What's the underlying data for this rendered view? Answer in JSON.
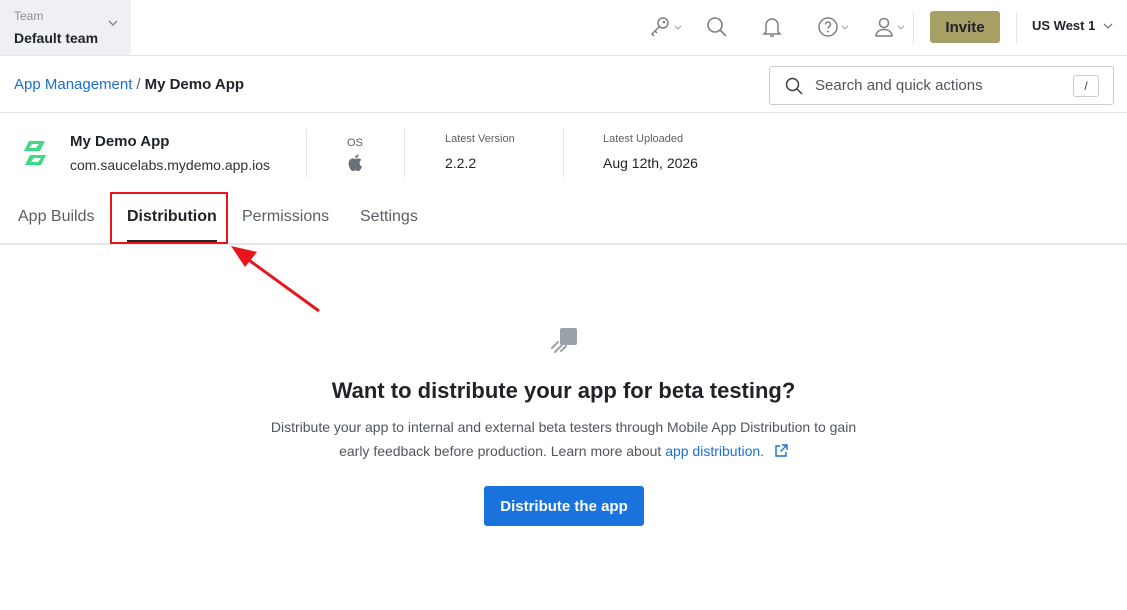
{
  "header": {
    "team_label": "Team",
    "team_name": "Default team",
    "invite_label": "Invite",
    "region_label": "US West 1",
    "icons": [
      "key-icon",
      "search-icon",
      "bell-icon",
      "help-icon",
      "user-icon"
    ]
  },
  "breadcrumb": {
    "parent": "App Management",
    "separator": "/",
    "current": "My Demo App"
  },
  "search": {
    "placeholder": "Search and quick actions",
    "shortcut": "/"
  },
  "app": {
    "name": "My Demo App",
    "bundle_id": "com.saucelabs.mydemo.app.ios",
    "os_label": "OS",
    "os_icon": "apple-icon",
    "latest_version_label": "Latest Version",
    "latest_version": "2.2.2",
    "latest_uploaded_label": "Latest Uploaded",
    "latest_uploaded": "Aug 12th, 2026",
    "brand_color": "#3ddc84"
  },
  "tabs": [
    {
      "label": "App Builds",
      "active": false
    },
    {
      "label": "Distribution",
      "active": true
    },
    {
      "label": "Permissions",
      "active": false
    },
    {
      "label": "Settings",
      "active": false
    }
  ],
  "empty_state": {
    "icon": "distribution-icon",
    "title": "Want to distribute your app for beta testing?",
    "description": "Distribute your app to internal and external beta testers through Mobile App Distribution to gain early feedback before production. Learn more about",
    "link_text": "app distribution",
    "after_link": ".",
    "button_label": "Distribute the app"
  },
  "colors": {
    "accent": "#1a73dc",
    "invite": "#a6a067",
    "annotation": "#e8161a"
  }
}
